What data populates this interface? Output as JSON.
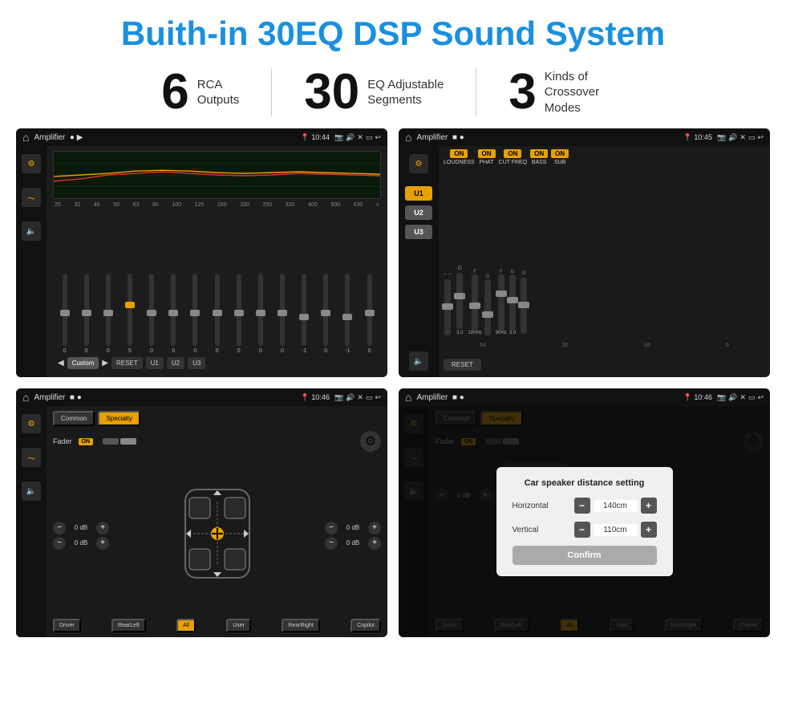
{
  "header": {
    "title": "Buith-in 30EQ DSP Sound System"
  },
  "stats": [
    {
      "number": "6",
      "label": "RCA\nOutputs"
    },
    {
      "number": "30",
      "label": "EQ Adjustable\nSegments"
    },
    {
      "number": "3",
      "label": "Kinds of\nCrossover Modes"
    }
  ],
  "screens": [
    {
      "id": "screen1",
      "status": {
        "title": "Amplifier",
        "time": "10:44"
      },
      "type": "eq"
    },
    {
      "id": "screen2",
      "status": {
        "title": "Amplifier",
        "time": "10:45"
      },
      "type": "amp"
    },
    {
      "id": "screen3",
      "status": {
        "title": "Amplifier",
        "time": "10:46"
      },
      "type": "fader"
    },
    {
      "id": "screen4",
      "status": {
        "title": "Amplifier",
        "time": "10:46"
      },
      "type": "dialog"
    }
  ],
  "eq": {
    "freq_labels": [
      "25",
      "32",
      "40",
      "50",
      "63",
      "80",
      "100",
      "125",
      "160",
      "200",
      "250",
      "320",
      "400",
      "500",
      "630"
    ],
    "values": [
      "0",
      "0",
      "0",
      "5",
      "0",
      "0",
      "0",
      "0",
      "0",
      "0",
      "0",
      "-1",
      "0",
      "-1"
    ],
    "buttons": [
      "Custom",
      "RESET",
      "U1",
      "U2",
      "U3"
    ]
  },
  "amp": {
    "u_buttons": [
      "U1",
      "U2",
      "U3"
    ],
    "toggles": [
      {
        "label": "LOUDNESS",
        "on": true
      },
      {
        "label": "PHAT",
        "on": true
      },
      {
        "label": "CUT FREQ",
        "on": true
      },
      {
        "label": "BASS",
        "on": true
      },
      {
        "label": "SUB",
        "on": true
      }
    ],
    "reset": "RESET"
  },
  "fader": {
    "tabs": [
      "Common",
      "Specialty"
    ],
    "active_tab": "Specialty",
    "fader_label": "Fader",
    "on_label": "ON",
    "vol_values": [
      "0 dB",
      "0 dB",
      "0 dB",
      "0 dB"
    ],
    "bottom_btns": [
      "Driver",
      "RearLeft",
      "All",
      "User",
      "RearRight",
      "Copilot"
    ]
  },
  "dialog": {
    "title": "Car speaker distance setting",
    "horizontal_label": "Horizontal",
    "horizontal_value": "140cm",
    "vertical_label": "Vertical",
    "vertical_value": "110cm",
    "confirm_label": "Confirm",
    "tabs": [
      "Common",
      "Specialty"
    ],
    "fader_label": "Fader",
    "on_label": "ON",
    "vol_values": [
      "0 dB",
      "0 dB"
    ],
    "bottom_btns": [
      "Driver",
      "RearLeft.",
      "All",
      "User",
      "RearRight",
      "Copilot"
    ]
  }
}
